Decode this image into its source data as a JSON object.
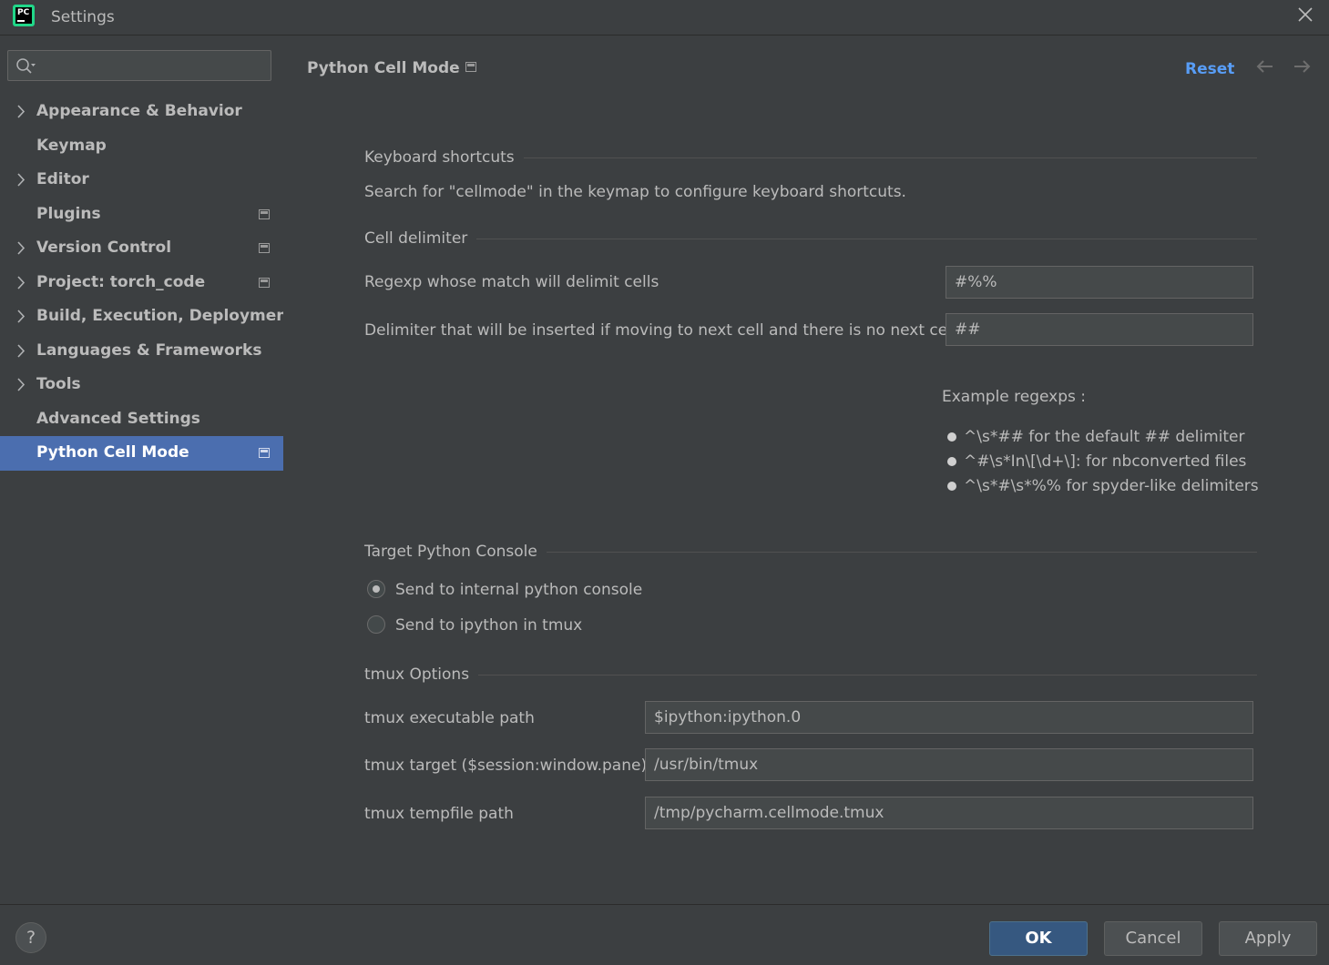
{
  "window": {
    "title": "Settings",
    "app_icon": "pycharm-logo",
    "logo_text": "PC"
  },
  "search": {
    "value": "",
    "placeholder": ""
  },
  "sidebar": {
    "items": [
      {
        "label": "Appearance & Behavior",
        "expandable": true,
        "project_icon": false,
        "selected": false
      },
      {
        "label": "Keymap",
        "expandable": false,
        "project_icon": false,
        "selected": false
      },
      {
        "label": "Editor",
        "expandable": true,
        "project_icon": false,
        "selected": false
      },
      {
        "label": "Plugins",
        "expandable": false,
        "project_icon": true,
        "selected": false
      },
      {
        "label": "Version Control",
        "expandable": true,
        "project_icon": true,
        "selected": false
      },
      {
        "label": "Project: torch_code",
        "expandable": true,
        "project_icon": true,
        "selected": false
      },
      {
        "label": "Build, Execution, Deployment",
        "expandable": true,
        "project_icon": false,
        "selected": false
      },
      {
        "label": "Languages & Frameworks",
        "expandable": true,
        "project_icon": false,
        "selected": false
      },
      {
        "label": "Tools",
        "expandable": true,
        "project_icon": false,
        "selected": false
      },
      {
        "label": "Advanced Settings",
        "expandable": false,
        "project_icon": false,
        "selected": false
      },
      {
        "label": "Python Cell Mode",
        "expandable": false,
        "project_icon": true,
        "selected": true
      }
    ]
  },
  "page": {
    "title": "Python Cell Mode",
    "reset": "Reset",
    "keyboard": {
      "title": "Keyboard shortcuts",
      "text": "Search for \"cellmode\" in the keymap to configure keyboard shortcuts."
    },
    "delimiter": {
      "title": "Cell delimiter",
      "regexp_label": "Regexp whose match will delimit cells",
      "regexp_value": "#%%",
      "insert_label": "Delimiter that will be inserted if moving to next cell and there is no next cell",
      "insert_value": "##",
      "examples_title": "Example regexps :",
      "examples": [
        "^\\s*## for the default ## delimiter",
        "^#\\s*In\\[\\d+\\]: for nbconverted files",
        "^\\s*#\\s*%% for spyder-like delimiters"
      ]
    },
    "target": {
      "title": "Target Python Console",
      "options": [
        {
          "label": "Send to internal python console",
          "checked": true
        },
        {
          "label": "Send to ipython in tmux",
          "checked": false
        }
      ]
    },
    "tmux": {
      "title": "tmux Options",
      "executable_label": "tmux executable path",
      "executable_value": "$ipython:ipython.0",
      "target_label": "tmux target ($session:window.pane)",
      "target_value": "/usr/bin/tmux",
      "tempfile_label": "tmux tempfile path",
      "tempfile_value": "/tmp/pycharm.cellmode.tmux"
    }
  },
  "footer": {
    "help": "?",
    "ok": "OK",
    "cancel": "Cancel",
    "apply": "Apply"
  },
  "colors": {
    "background": "#3c3f41",
    "selection": "#4b6eaf",
    "link": "#589df6",
    "primary_button": "#365880"
  }
}
